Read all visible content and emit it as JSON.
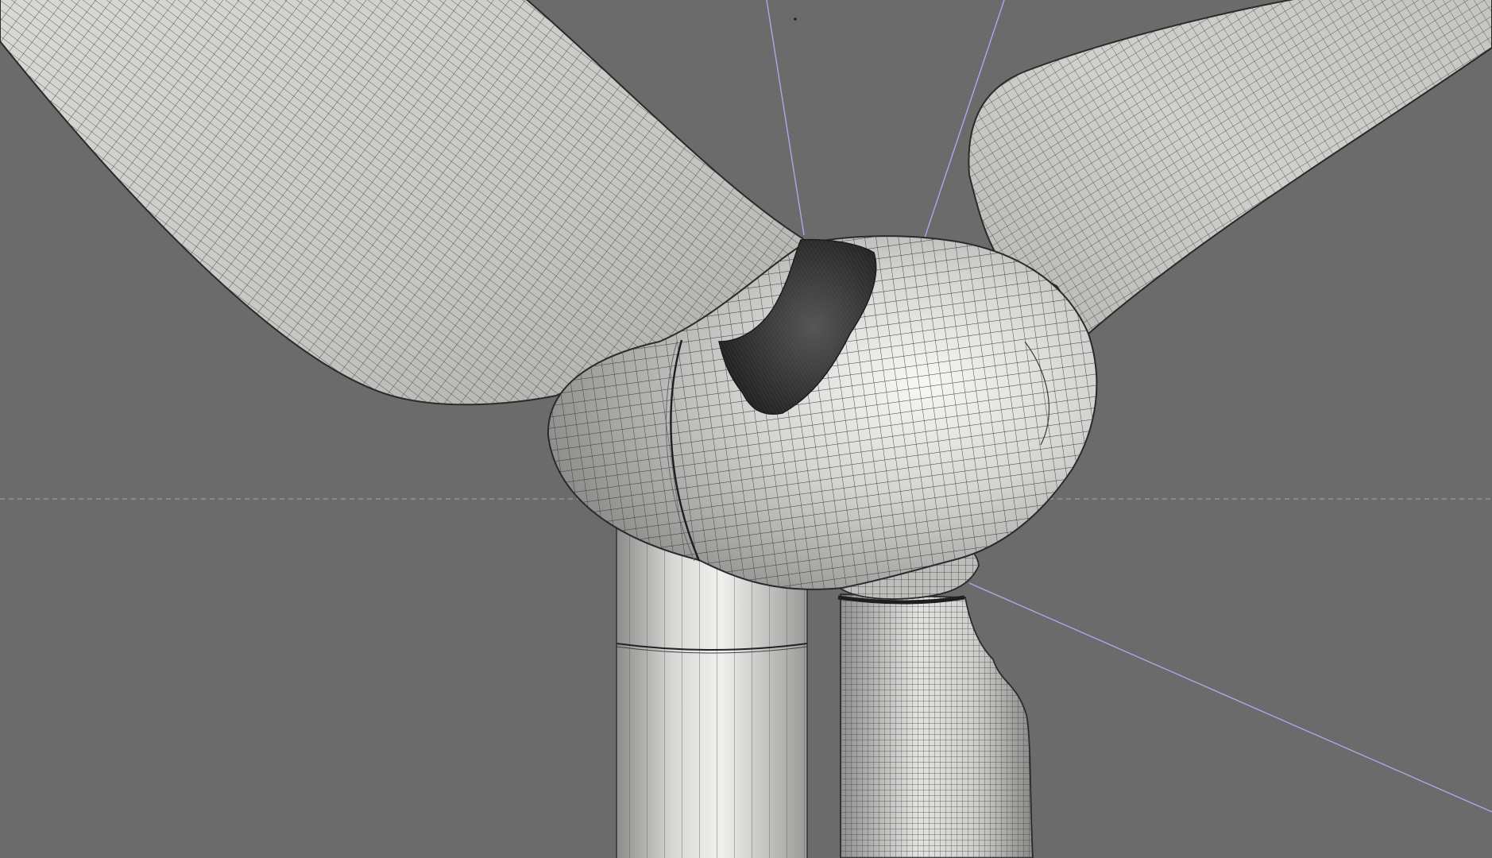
{
  "viewport": {
    "background_color": "#6b6b6b",
    "render_mode": "surface-with-mesh",
    "model": "wind-turbine-rotor-hub",
    "surface_color": "#c9c9c9",
    "mesh_line_color": "#333333",
    "cut_face_color": "#2a2a2a",
    "axis_color": "#a9a9e9",
    "guide_line_color": "#a8a8a8"
  }
}
